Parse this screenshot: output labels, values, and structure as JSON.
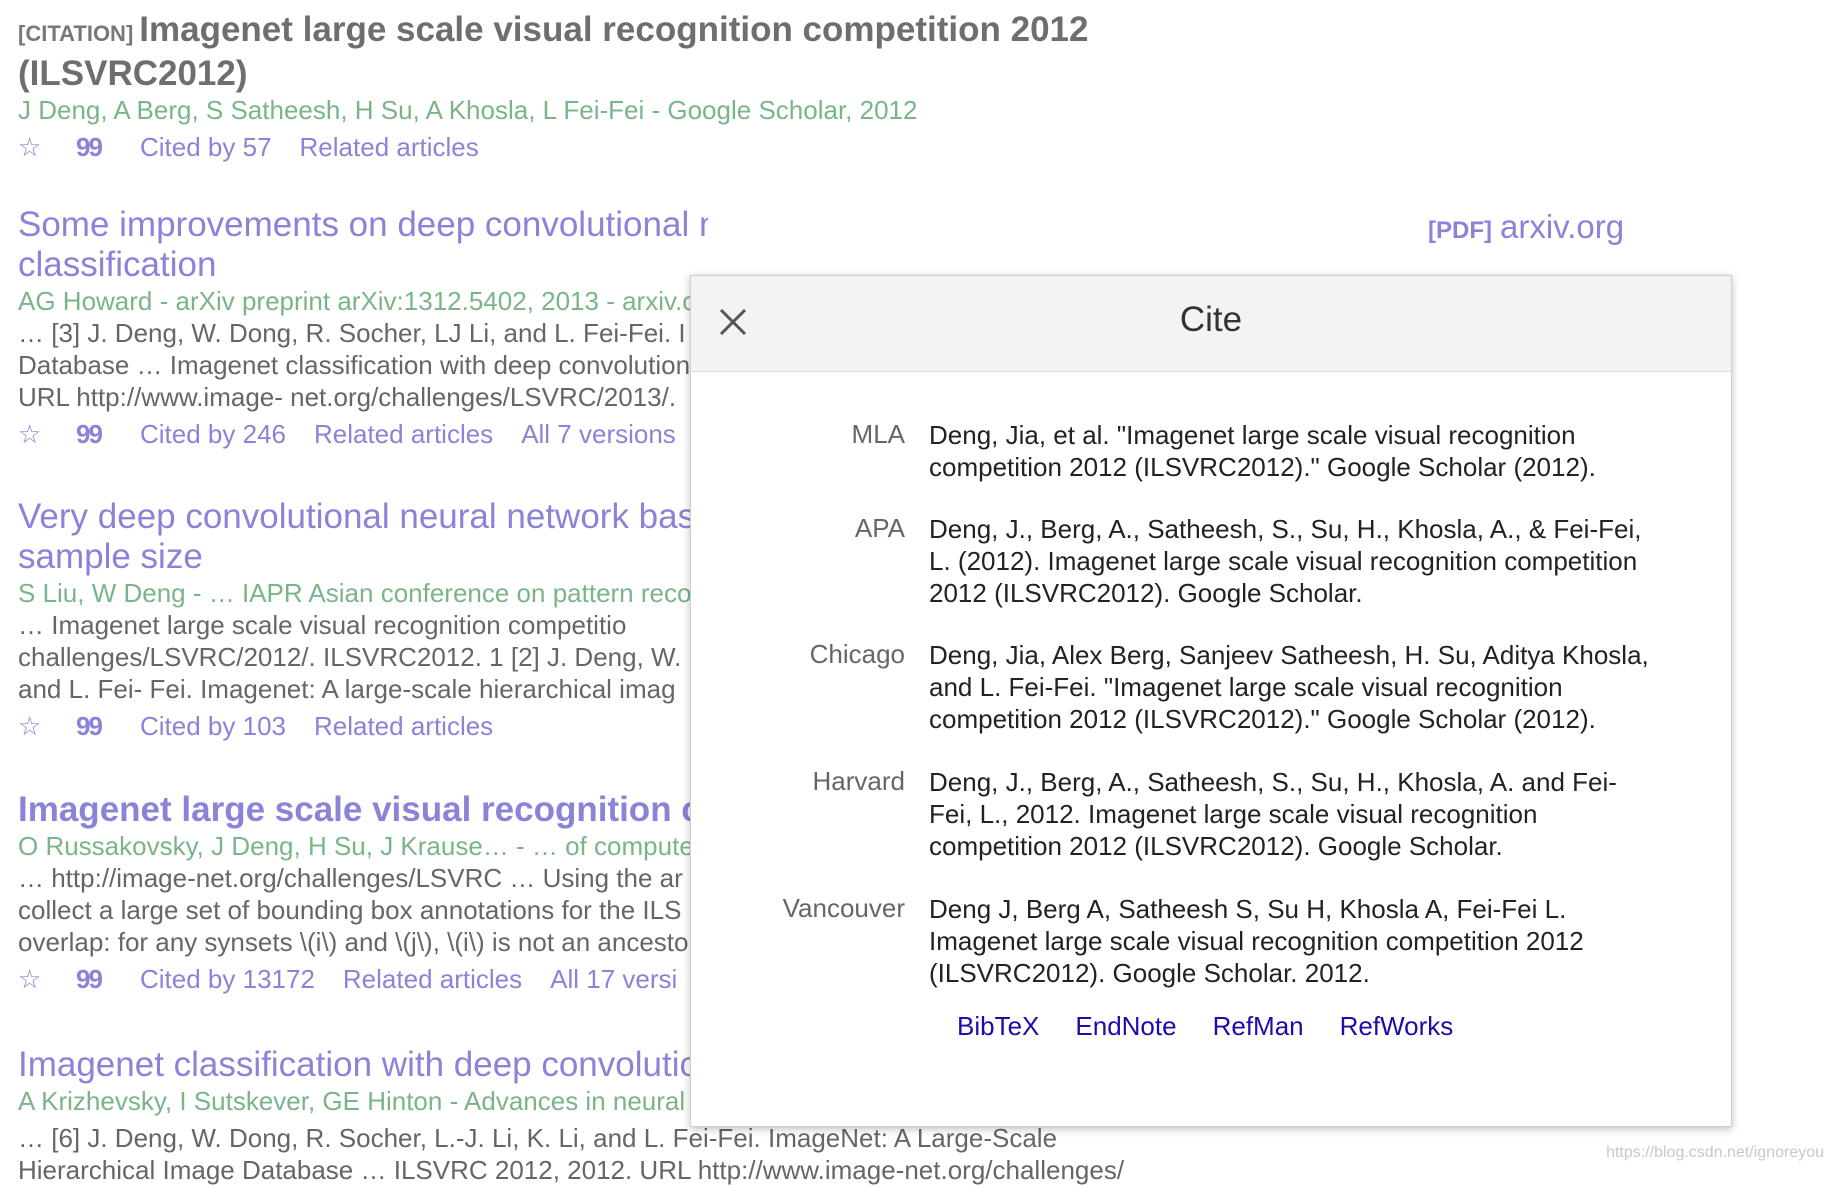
{
  "results": [
    {
      "tag": "[CITATION]",
      "title_html": "Imagenet large scale visual recognition competition 2012 (ILSVRC2012)",
      "authors": "J Deng, A Berg, S Satheesh, H Su, A Khosla, L Fei-Fei - Google Scholar, 2012",
      "cited_by": "Cited by 57",
      "related": "Related articles"
    },
    {
      "title": "Some improvements on deep convolutional neural network based image classification",
      "pdf_tag": "[PDF]",
      "pdf_source": "arxiv.org",
      "authors": "AG Howard - arXiv preprint arXiv:1312.5402, 2013 - arxiv.o",
      "snippet": [
        "… [3] J. Deng, W. Dong, R. Socher, LJ Li, and L. Fei-Fei. I",
        "Database … Imagenet classification with deep convolution",
        "URL http://www.image- net.org/challenges/LSVRC/2013/."
      ],
      "cited_by": "Cited by 246",
      "related": "Related articles",
      "versions": "All 7 versions"
    },
    {
      "title": "Very deep convolutional neural network based training sample size",
      "authors": "S Liu, W Deng - … IAPR Asian conference on pattern reco",
      "snippet": [
        "… Imagenet large scale visual recognition competitio",
        "challenges/LSVRC/2012/. ILSVRC2012. 1 [2] J. Deng, W.",
        "and L. Fei- Fei. Imagenet: A large-scale hierarchical imag"
      ],
      "cited_by": "Cited by 103",
      "related": "Related articles"
    },
    {
      "title": "Imagenet large scale visual recognition ch",
      "authors": "O Russakovsky, J Deng, H Su, J Krause… - … of compute",
      "snippet": [
        "… http://image-net.org/challenges/LSVRC … Using the ar",
        "collect a large set of bounding box annotations for the ILS",
        "overlap: for any synsets \\(i\\) and \\(j\\), \\(i\\) is not an ancesto"
      ],
      "cited_by": "Cited by 13172",
      "related": "Related articles",
      "versions": "All 17 versi"
    },
    {
      "title": "Imagenet classification with deep convolutio",
      "authors": "A Krizhevsky, I Sutskever, GE Hinton - Advances in neural",
      "snippet": [
        "… [6] J. Deng, W. Dong, R. Socher, L.-J. Li, K. Li, and L. Fei-Fei. ImageNet: A Large-Scale",
        "Hierarchical Image Database … ILSVRC 2012, 2012. URL http://www.image-net.org/challenges/"
      ]
    }
  ],
  "modal": {
    "title": "Cite",
    "rows": [
      {
        "style": "MLA",
        "text": "Deng, Jia, et al. \"Imagenet large scale visual recognition competition 2012 (ILSVRC2012).\" Google Scholar (2012)."
      },
      {
        "style": "APA",
        "text": "Deng, J., Berg, A., Satheesh, S., Su, H., Khosla, A., & Fei-Fei, L. (2012). Imagenet large scale visual recognition competition 2012 (ILSVRC2012). Google Scholar."
      },
      {
        "style": "Chicago",
        "text": "Deng, Jia, Alex Berg, Sanjeev Satheesh, H. Su, Aditya Khosla, and L. Fei-Fei. \"Imagenet large scale visual recognition competition 2012 (ILSVRC2012).\" Google Scholar (2012)."
      },
      {
        "style": "Harvard",
        "text": "Deng, J., Berg, A., Satheesh, S., Su, H., Khosla, A. and Fei-Fei, L., 2012. Imagenet large scale visual recognition competition 2012 (ILSVRC2012). Google Scholar."
      },
      {
        "style": "Vancouver",
        "text": "Deng J, Berg A, Satheesh S, Su H, Khosla A, Fei-Fei L. Imagenet large scale visual recognition competition 2012 (ILSVRC2012). Google Scholar. 2012."
      }
    ],
    "export_links": [
      "BibTeX",
      "EndNote",
      "RefMan",
      "RefWorks"
    ]
  },
  "watermark": "https://blog.csdn.net/ignoreyou",
  "colors": {
    "link": "#8a83d8",
    "authors": "#7ab58a",
    "export_link": "#1a0dab"
  },
  "icons": {
    "save": "star-icon",
    "cite": "quote-icon",
    "close": "close-icon"
  }
}
